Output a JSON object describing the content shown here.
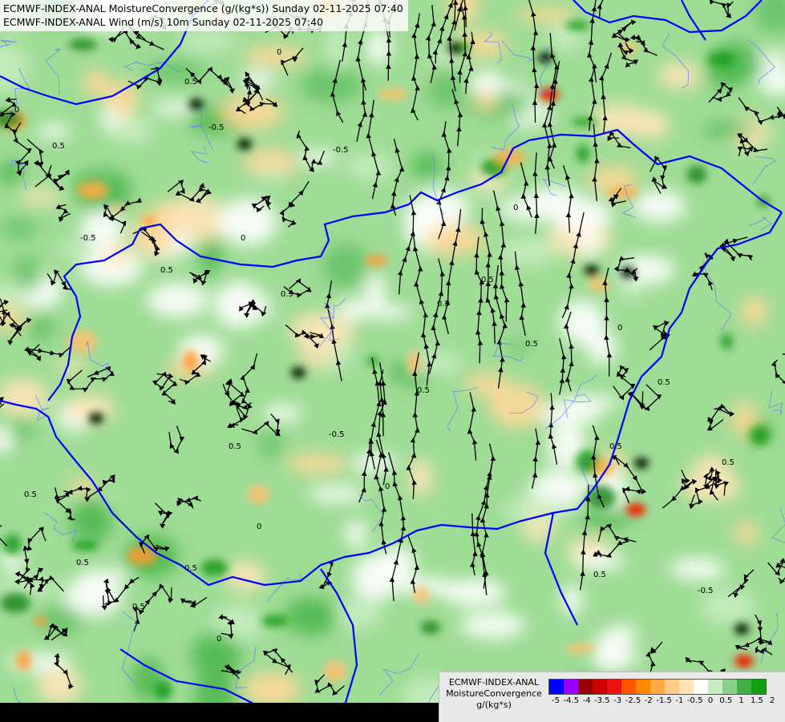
{
  "header": {
    "line1": "ECMWF-INDEX-ANAL MoistureConvergence (g/(kg*s)) Sunday 02-11-2025 07:40",
    "line2": "ECMWF-INDEX-ANAL Wind (m/s) 10m Sunday 02-11-2025 07:40"
  },
  "legend": {
    "title_line1": "ECMWF-INDEX-ANAL",
    "title_line2": "MoistureConvergence",
    "unit": "g/(kg*s)",
    "ticks": [
      "-5",
      "-4.5",
      "-4",
      "-3.5",
      "-3",
      "-2.5",
      "-2",
      "-1.5",
      "-1",
      "-0.5",
      "0",
      "0.5",
      "1",
      "1.5",
      "2"
    ],
    "colors": [
      "#0000ff",
      "#9900ff",
      "#990000",
      "#cc0000",
      "#ee1111",
      "#ff5500",
      "#ff8800",
      "#ffaa44",
      "#ffcc88",
      "#ffe4b8",
      "#ffffff",
      "#c8ecc0",
      "#88d088",
      "#44b044",
      "#11a011"
    ]
  },
  "contour_labels": [
    "0.5",
    "0",
    "-0.5",
    "0.5",
    "0",
    "-0.5",
    "0.5",
    "0",
    "0.5",
    "-0.5",
    "0.5",
    "0",
    "0.5",
    "0.5",
    "0",
    "0.5",
    "0.5",
    "0.5",
    "-0.5",
    "0.5",
    "0",
    "0.5",
    "0.5",
    "0",
    "0.5",
    "-0.5",
    "0.5",
    "0",
    "0.5",
    "0.5"
  ],
  "colors": {
    "border": "#0000ff",
    "river": "#6677ff",
    "streamline": "#000000"
  }
}
